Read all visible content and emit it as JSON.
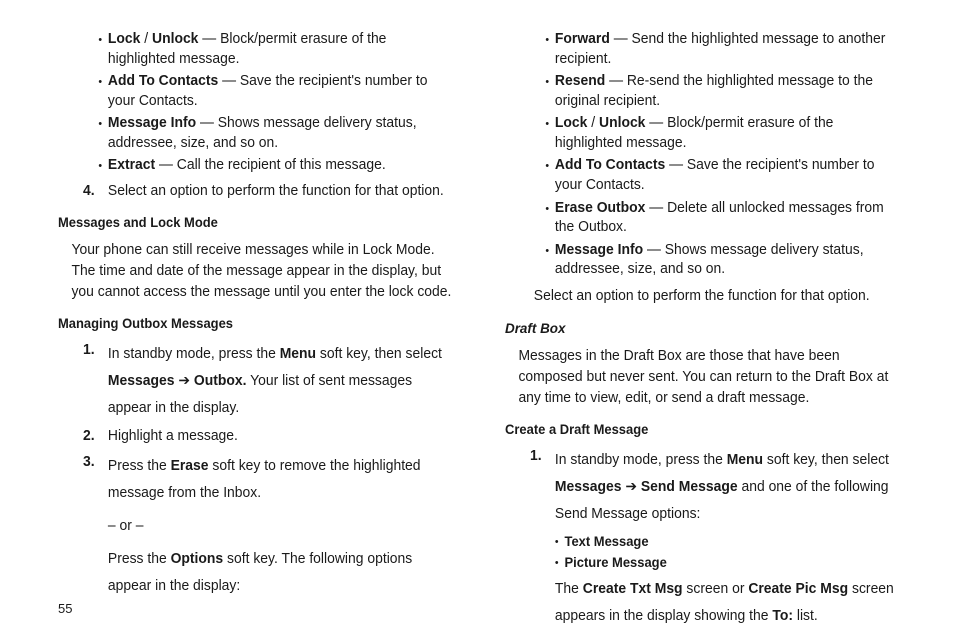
{
  "pageNumber": "55",
  "left": {
    "topBullets": [
      {
        "bold": "Lock",
        "sep": " / ",
        "bold2": "Unlock",
        "tail": " — Block/permit erasure of the highlighted message."
      },
      {
        "bold": "Add To Contacts",
        "tail": " — Save the recipient's number to your Contacts."
      },
      {
        "bold": "Message Info",
        "tail": " — Shows message delivery status, addressee, size, and so on."
      },
      {
        "bold": "Extract",
        "tail": " — Call the recipient of this message."
      }
    ],
    "step4": {
      "num": "4.",
      "text": "Select an option to perform the function for that option."
    },
    "h1": "Messages and Lock Mode",
    "p1": "Your phone can still receive messages while in Lock Mode. The time and date of the message appear in the display, but you cannot access the message until you enter the lock code.",
    "h2": "Managing Outbox Messages",
    "s1": {
      "num": "1.",
      "pre": "In standby mode, press the ",
      "b1": "Menu",
      "mid": " soft key, then select ",
      "b2": "Messages",
      "arrow": " ➔ ",
      "b3": "Outbox.",
      "tail": " Your list of sent messages appear in the display."
    },
    "s2": {
      "num": "2.",
      "text": "Highlight a message."
    },
    "s3": {
      "num": "3.",
      "pre": "Press the ",
      "b1": "Erase",
      "tail": " soft key to remove the highlighted message from the Inbox."
    },
    "or": "– or –",
    "s3b": {
      "pre": "Press the ",
      "b1": "Options",
      "tail": " soft key. The following options appear in the display:"
    }
  },
  "right": {
    "topBullets": [
      {
        "bold": "Forward",
        "tail": " — Send the highlighted message to another recipient."
      },
      {
        "bold": "Resend",
        "tail": " — Re-send the highlighted message to the original recipient."
      },
      {
        "bold": "Lock",
        "sep": " / ",
        "bold2": "Unlock",
        "tail": " — Block/permit erasure of the highlighted message."
      },
      {
        "bold": "Add To Contacts",
        "tail": " — Save the recipient's number to your Contacts."
      },
      {
        "bold": "Erase Outbox",
        "tail": " — Delete all unlocked messages from the Outbox."
      },
      {
        "bold": "Message Info",
        "tail": " — Shows message delivery status, addressee, size, and so on."
      }
    ],
    "selectLine": "Select an option to perform the function for that option.",
    "h1": "Draft Box",
    "p1": "Messages in the Draft Box are those that have been composed but never sent. You can return to the Draft Box at any time to view, edit, or send a draft message.",
    "h2": "Create a Draft Message",
    "s1": {
      "num": "1.",
      "pre": "In standby mode, press the ",
      "b1": "Menu",
      "mid": " soft key, then select ",
      "b2": "Messages",
      "arrow": " ➔ ",
      "b3": "Send Message",
      "tail": " and one of the following Send Message options:"
    },
    "subBullets": [
      "Text Message",
      "Picture Message"
    ],
    "s1b": {
      "pre": "The ",
      "b1": "Create Txt Msg",
      "mid": " screen or ",
      "b2": "Create Pic Msg",
      "mid2": " screen appears in the display showing the ",
      "b3": "To:",
      "tail": " list."
    }
  }
}
